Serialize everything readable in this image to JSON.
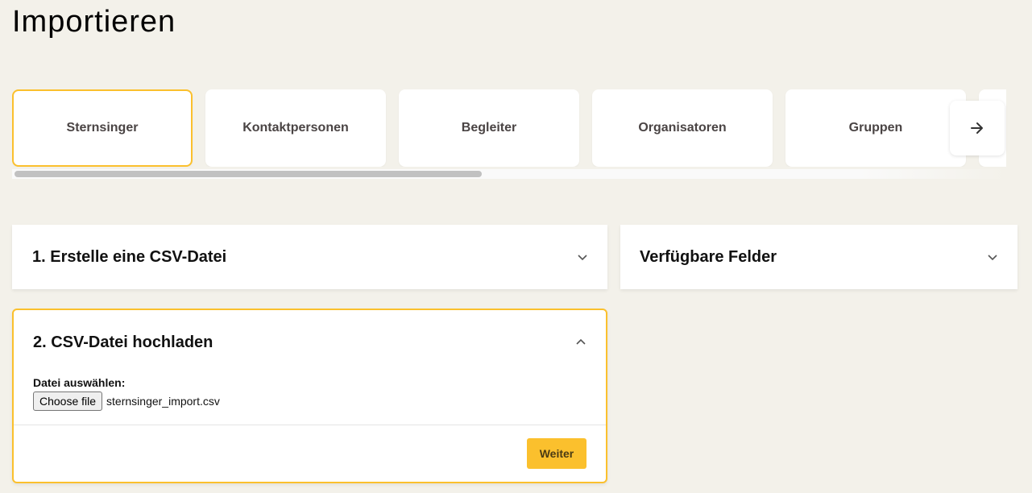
{
  "page": {
    "title": "Importieren"
  },
  "tabs": [
    {
      "label": "Sternsinger",
      "active": true
    },
    {
      "label": "Kontaktpersonen",
      "active": false
    },
    {
      "label": "Begleiter",
      "active": false
    },
    {
      "label": "Organisatoren",
      "active": false
    },
    {
      "label": "Gruppen",
      "active": false
    }
  ],
  "tab_scroll_icon": "arrow-right-icon",
  "panels": {
    "csv": {
      "title": "1. Erstelle eine CSV-Datei",
      "expanded": false,
      "icon": "chevron-down-icon"
    },
    "fields": {
      "title": "Verfügbare Felder",
      "expanded": false,
      "icon": "chevron-down-icon"
    },
    "upload": {
      "title": "2. CSV-Datei hochladen",
      "expanded": true,
      "icon": "chevron-up-icon",
      "file_label": "Datei auswählen:",
      "choose_button": "Choose file",
      "file_name": "sternsinger_import.csv",
      "submit_label": "Weiter"
    }
  },
  "colors": {
    "background": "#f3f1ea",
    "accent": "#fbc02d",
    "card": "#ffffff",
    "tab_text": "#4a4444"
  }
}
